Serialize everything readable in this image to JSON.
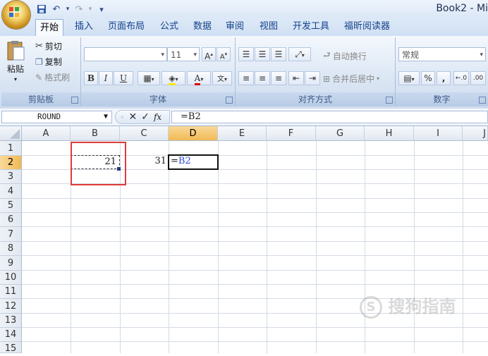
{
  "window": {
    "title": "Book2 - Mi"
  },
  "quick_access": {
    "save": "save-icon",
    "undo": "undo-icon",
    "redo": "redo-icon",
    "customize": "▾"
  },
  "tabs": [
    "开始",
    "插入",
    "页面布局",
    "公式",
    "数据",
    "审阅",
    "视图",
    "开发工具",
    "福昕阅读器"
  ],
  "active_tab": "开始",
  "ribbon": {
    "clipboard": {
      "paste": "粘贴",
      "cut": "剪切",
      "copy": "复制",
      "format_painter": "格式刷",
      "label": "剪贴板"
    },
    "font": {
      "font_size": "11",
      "bold": "B",
      "italic": "I",
      "underline": "U",
      "label": "字体"
    },
    "alignment": {
      "wrap_text": "自动换行",
      "merge_center": "合并后居中",
      "label": "对齐方式"
    },
    "number": {
      "format": "常规",
      "percent": "%",
      "comma": ",",
      "label": "数字"
    }
  },
  "formula_bar": {
    "name_box": "ROUND",
    "formula": "=B2",
    "fx": "fx"
  },
  "columns": [
    "A",
    "B",
    "C",
    "D",
    "E",
    "F",
    "G",
    "H",
    "I",
    "J"
  ],
  "rows": [
    "1",
    "2",
    "3",
    "4",
    "5",
    "6",
    "7",
    "8",
    "9",
    "10",
    "11",
    "12",
    "13",
    "14",
    "15"
  ],
  "cells": {
    "B2": "21",
    "C2": "31",
    "D2_prefix": "=",
    "D2_ref": "B2"
  },
  "selected_column": "D",
  "selected_row": "2",
  "colors": {
    "ref_blue": "#2a4bd7",
    "highlight_red": "#e03a3a",
    "accent": "#f1b953"
  },
  "watermark": "搜狗指南"
}
